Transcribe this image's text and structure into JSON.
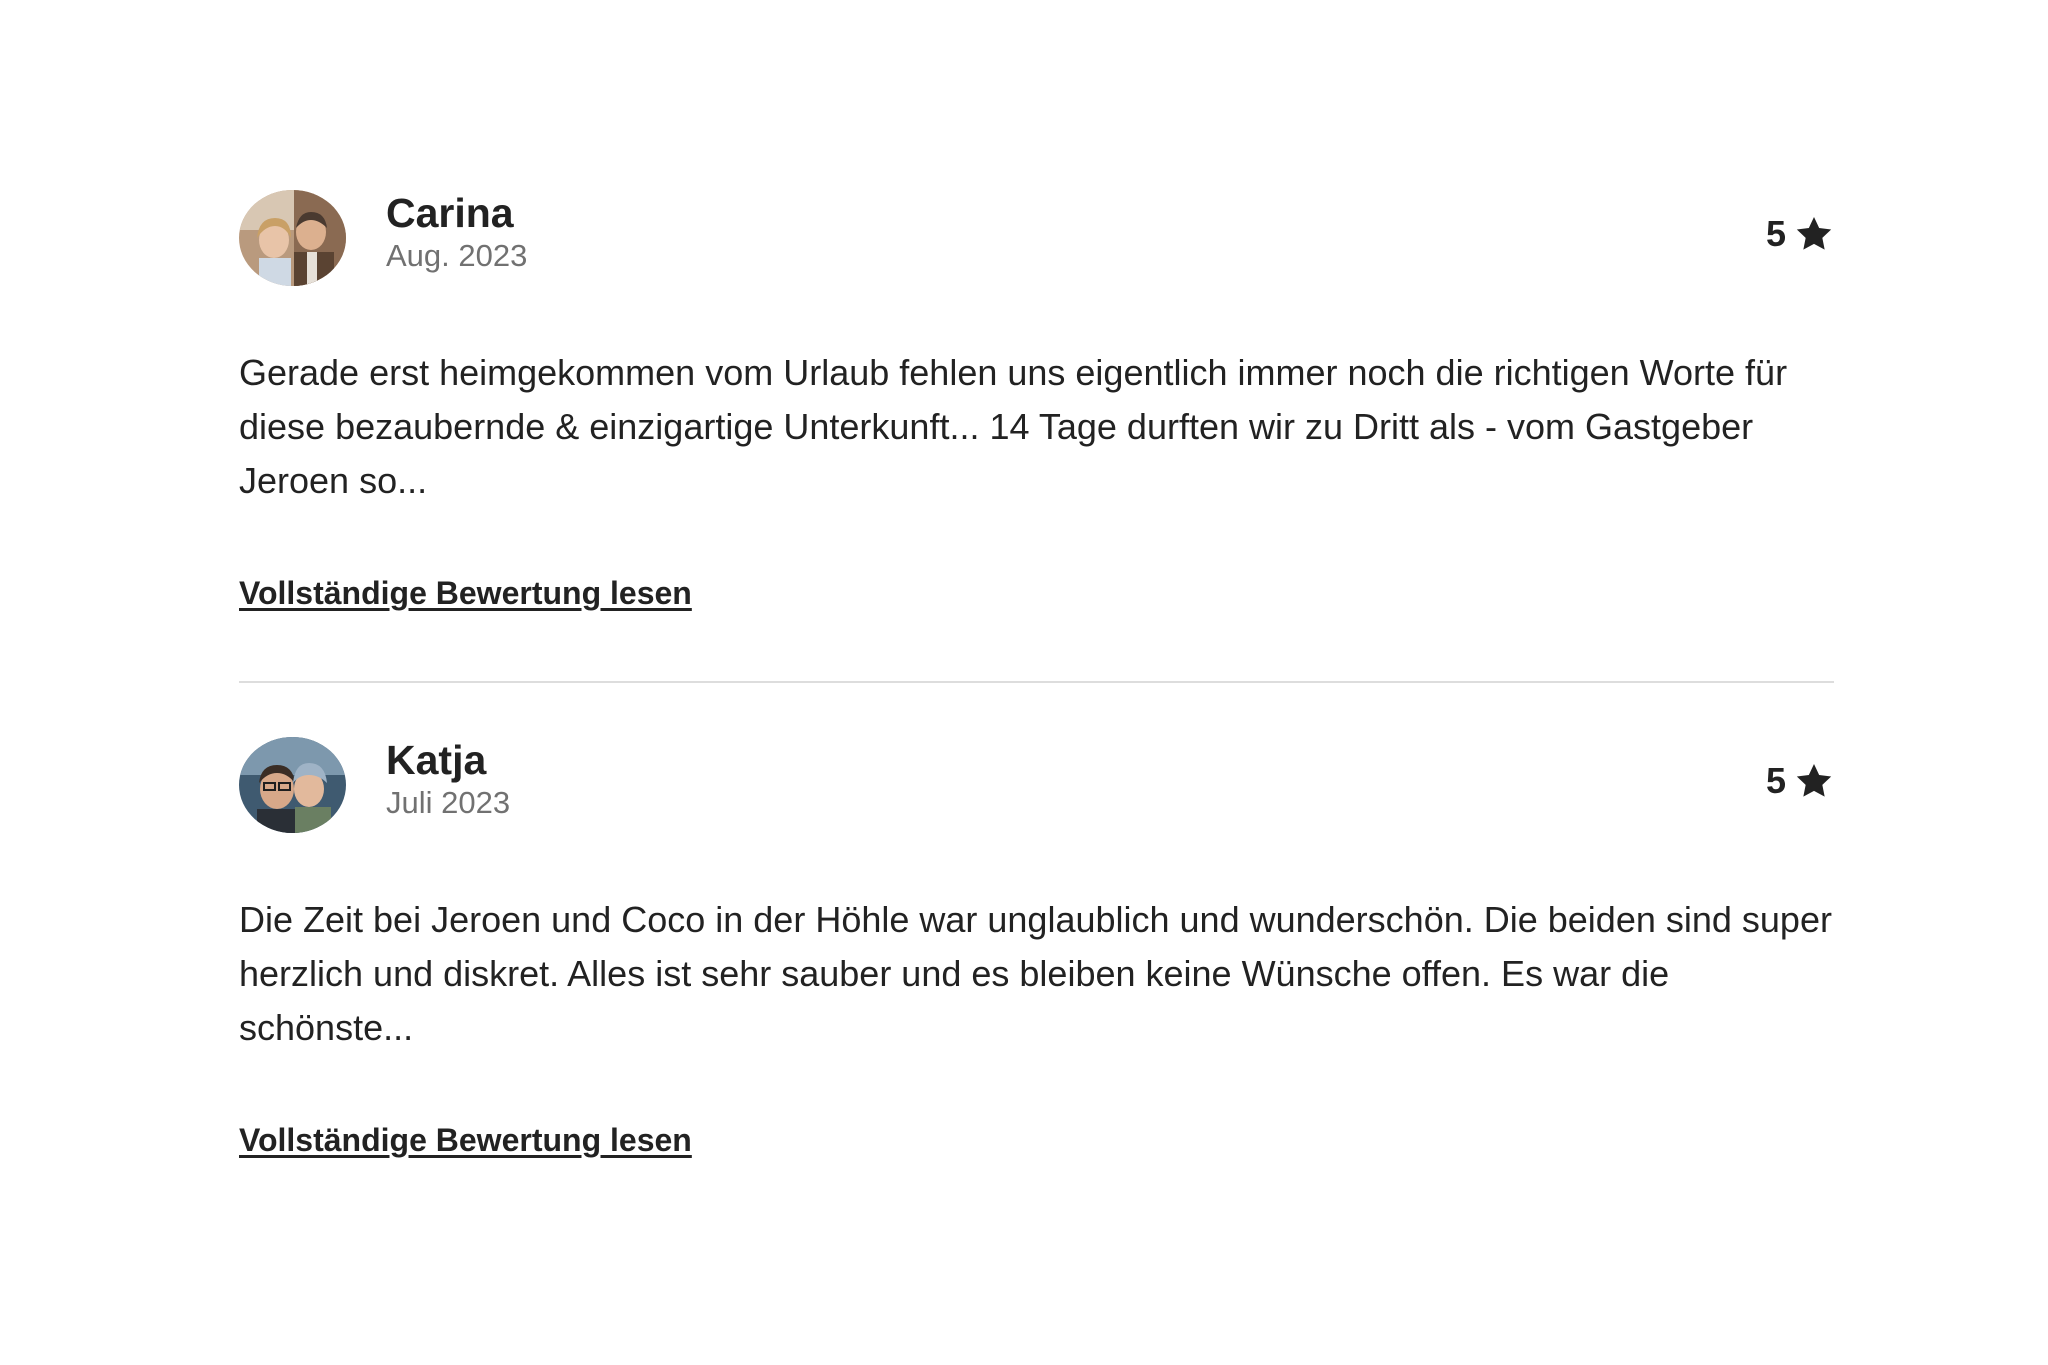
{
  "reviews": [
    {
      "author": "Carina",
      "date": "Aug. 2023",
      "rating": "5",
      "text": "Gerade erst heimgekommen vom Urlaub fehlen uns eigentlich immer noch die richtigen Worte für diese bezaubernde & einzigartige Unterkunft... 14 Tage durften wir zu Dritt als - vom Gastgeber Jeroen so...",
      "read_more": "Vollständige Bewertung lesen"
    },
    {
      "author": "Katja",
      "date": "Juli 2023",
      "rating": "5",
      "text": "Die Zeit bei Jeroen und Coco in der Höhle war unglaublich und wunderschön. Die beiden sind super herzlich und diskret. Alles ist sehr sauber und es bleiben keine Wünsche offen. Es war die schönste...",
      "read_more": "Vollständige Bewertung lesen"
    }
  ],
  "icons": {
    "rating": "star-icon",
    "avatar": "avatar-photo"
  },
  "colors": {
    "text": "#222222",
    "muted": "#717171",
    "divider": "#dddddd",
    "background": "#ffffff"
  }
}
